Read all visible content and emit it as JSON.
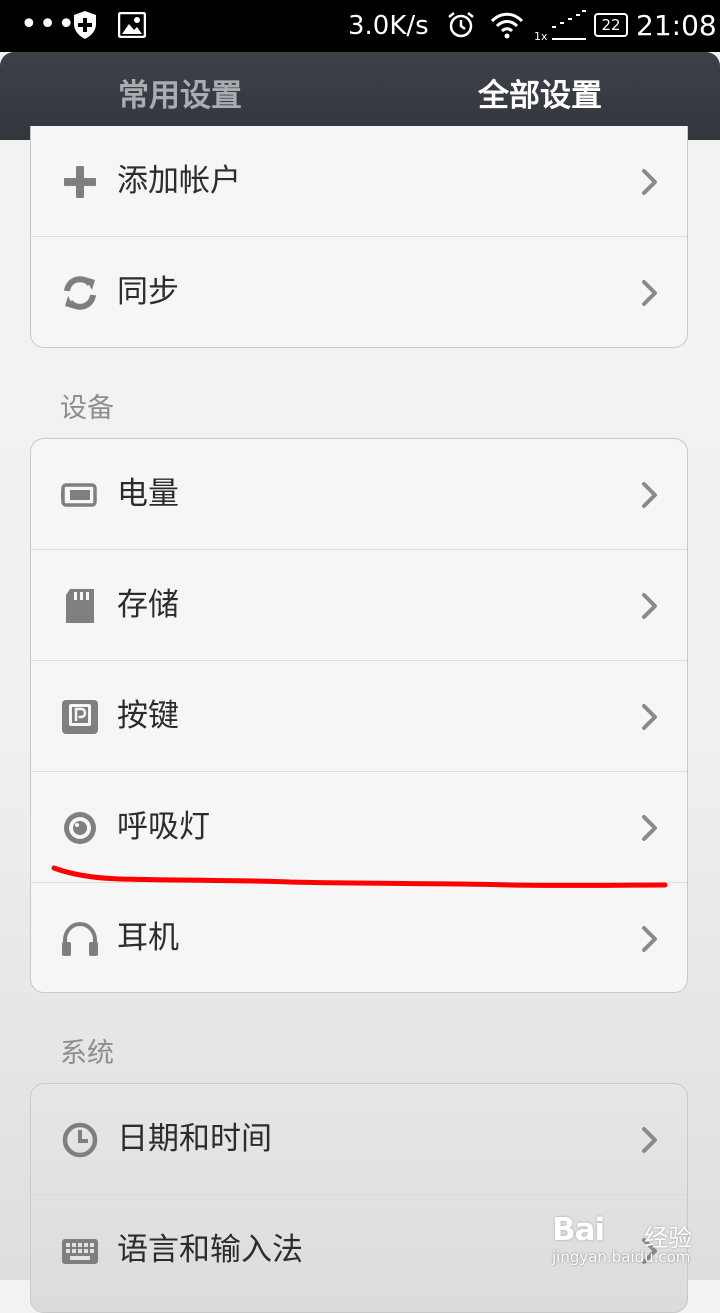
{
  "status_bar": {
    "dots": "•••",
    "speed": "3.0K/s",
    "signal_label": "1x",
    "battery": "22",
    "time": "21:08"
  },
  "tabs": [
    {
      "label": "常用设置",
      "selected": false
    },
    {
      "label": "全部设置",
      "selected": true
    }
  ],
  "accounts_group": {
    "items": [
      {
        "label": "添加帐户",
        "icon": "plus-icon"
      },
      {
        "label": "同步",
        "icon": "sync-icon"
      }
    ]
  },
  "device_section": {
    "title": "设备",
    "items": [
      {
        "label": "电量",
        "icon": "battery-icon"
      },
      {
        "label": "存储",
        "icon": "sd-card-icon"
      },
      {
        "label": "按键",
        "icon": "key-icon"
      },
      {
        "label": "呼吸灯",
        "icon": "led-icon"
      },
      {
        "label": "耳机",
        "icon": "headphones-icon"
      }
    ]
  },
  "system_section": {
    "title": "系统",
    "items": [
      {
        "label": "日期和时间",
        "icon": "clock-icon"
      },
      {
        "label": "语言和输入法",
        "icon": "keyboard-icon"
      }
    ]
  },
  "watermark": {
    "logo": "Bai",
    "logo_suffix": "经验",
    "url": "jingyan.baidu.com"
  },
  "colors": {
    "tab_bar": "#3a3d43",
    "annotation_line": "#ff0000",
    "icon_gray": "#7f7f7f"
  }
}
